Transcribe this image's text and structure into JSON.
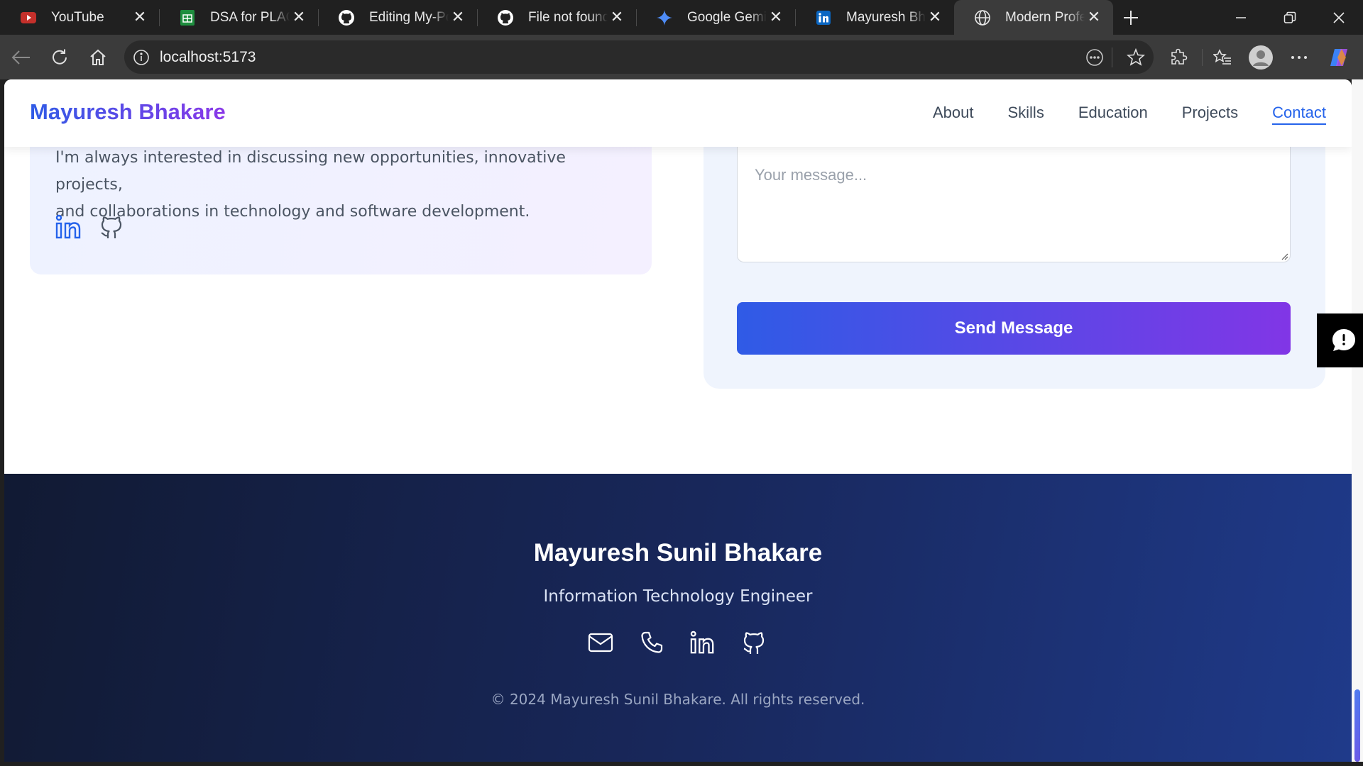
{
  "browser": {
    "tabs": [
      {
        "title": "YouTube",
        "icon": "youtube-icon",
        "color": "#ff0000"
      },
      {
        "title": "DSA for PLACEMENTS",
        "icon": "google-sheets-icon",
        "color": "#1e8e3e"
      },
      {
        "title": "Editing My-Portfolio",
        "icon": "github-icon",
        "color": "#ffffff"
      },
      {
        "title": "File not found",
        "icon": "github-icon",
        "color": "#ffffff"
      },
      {
        "title": "Google Gemini",
        "icon": "gemini-icon",
        "color": "#4e8cf7"
      },
      {
        "title": "Mayuresh Bhakare",
        "icon": "linkedin-icon",
        "color": "#0a66c2"
      },
      {
        "title": "Modern Professional",
        "icon": "globe-icon",
        "color": "#ffffff",
        "active": true
      }
    ],
    "address": "localhost:5173"
  },
  "navbar": {
    "brand": "Mayuresh Bhakare",
    "links": [
      "About",
      "Skills",
      "Education",
      "Projects",
      "Contact"
    ],
    "active": "Contact"
  },
  "contact": {
    "intro_line1": "I'm always interested in discussing new opportunities, innovative projects,",
    "intro_line2": "and collaborations in technology and software development.",
    "message_placeholder": "Your message...",
    "send_label": "Send Message"
  },
  "footer": {
    "name": "Mayuresh Sunil Bhakare",
    "role": "Information Technology Engineer",
    "copyright": "© 2024 Mayuresh Sunil Bhakare. All rights reserved."
  },
  "colors": {
    "accent_blue": "#2563eb",
    "accent_purple": "#8136e6",
    "footer_dark": "#111a33"
  }
}
